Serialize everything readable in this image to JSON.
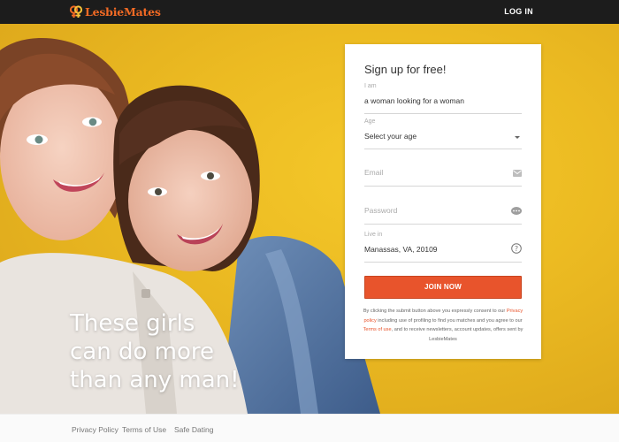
{
  "header": {
    "brand": "LesbieMates",
    "login_label": "LOG IN"
  },
  "hero": {
    "tagline_lines": [
      "These girls",
      "can do more",
      "than any man!"
    ]
  },
  "signup": {
    "title": "Sign up for free!",
    "i_am_label": "I am",
    "i_am_value": "a woman looking for a woman",
    "age_label": "Age",
    "age_value": "Select your age",
    "email_placeholder": "Email",
    "password_placeholder": "Password",
    "live_in_label": "Live in",
    "live_in_value": "Manassas, VA, 20109",
    "join_label": "JOIN NOW",
    "legal_1": "By clicking the submit button above you expressly consent to our ",
    "legal_privacy_link": "Privacy policy",
    "legal_2": " including use of profiling to find you matches and you agree to our ",
    "legal_terms_link": "Terms of use",
    "legal_3": ", and to receive newsletters, account updates, offers sent by LesbieMates"
  },
  "footer": {
    "privacy": "Privacy Policy",
    "terms": "Terms of Use",
    "safe_dating": "Safe Dating"
  },
  "colors": {
    "accent": "#e8542c",
    "hero_bg": "#ecbb22",
    "topbar": "#1c1c1c"
  },
  "icons": {
    "logo": "female-symbols-icon",
    "email": "envelope-icon",
    "password": "dots-icon",
    "location": "question-circle-icon",
    "select": "chevron-down-icon"
  }
}
